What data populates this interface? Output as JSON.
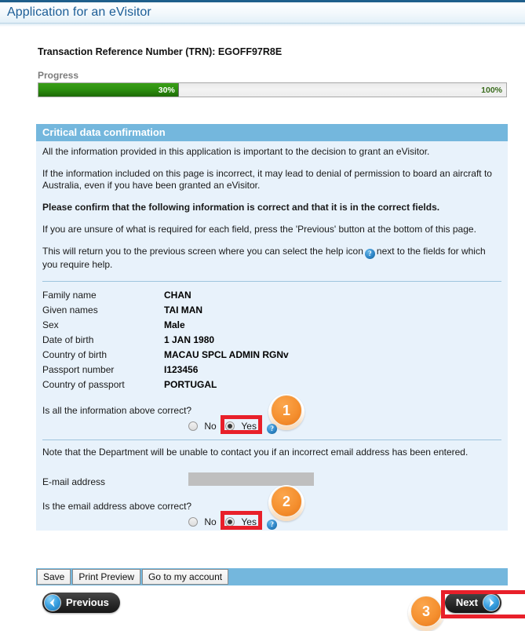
{
  "window": {
    "title": "Application for an eVisitor"
  },
  "trn": {
    "text": "Transaction Reference Number (TRN): EGOFF97R8E"
  },
  "progress": {
    "label": "Progress",
    "current_label": "30%",
    "max_label": "100%",
    "percent": 30,
    "fill_color": "#2e9110"
  },
  "panel": {
    "header": "Critical data confirmation",
    "header_color": "#74b7dd",
    "background_color": "#e8f2fb",
    "paragraphs": {
      "p1": "All the information provided in this application is important to the decision to grant an eVisitor.",
      "p2": "If the information included on this page is incorrect, it may lead to denial of permission to board an aircraft to Australia, even if you have been granted an eVisitor.",
      "p3": "Please confirm that the following information is correct and that it is in the correct fields.",
      "p4": "If you are unsure of what is required for each field, press the 'Previous' button at the bottom of this page.",
      "p5a": "This will return you to the previous screen where you can select the help icon",
      "p5b": "next to the fields for which you require help.",
      "note_email": "Note that the Department will be unable to contact you if an incorrect email address has been entered."
    },
    "help_icon_glyph": "?"
  },
  "details": [
    {
      "label": "Family name",
      "value": "CHAN"
    },
    {
      "label": "Given names",
      "value": "TAI MAN"
    },
    {
      "label": "Sex",
      "value": "Male"
    },
    {
      "label": "Date of birth",
      "value": "1 JAN 1980"
    },
    {
      "label": "Country of birth",
      "value": "MACAU SPCL ADMIN RGNv"
    },
    {
      "label": "Passport number",
      "value": "I123456"
    },
    {
      "label": "Country of passport",
      "value": "PORTUGAL"
    }
  ],
  "question1": {
    "text": "Is all the information above correct?",
    "option_no": "No",
    "option_yes": "Yes",
    "selected": "Yes",
    "badge": "1",
    "highlight_color": "#e8202a"
  },
  "email": {
    "label": "E-mail address",
    "value": ""
  },
  "question2": {
    "text": "Is the email address above correct?",
    "option_no": "No",
    "option_yes": "Yes",
    "selected": "Yes",
    "badge": "2",
    "highlight_color": "#e8202a"
  },
  "toolbar": {
    "save": "Save",
    "print_preview": "Print Preview",
    "go_to_my_account": "Go to my account"
  },
  "nav": {
    "previous": "Previous",
    "next": "Next",
    "badge": "3",
    "highlight_color": "#e8202a"
  }
}
